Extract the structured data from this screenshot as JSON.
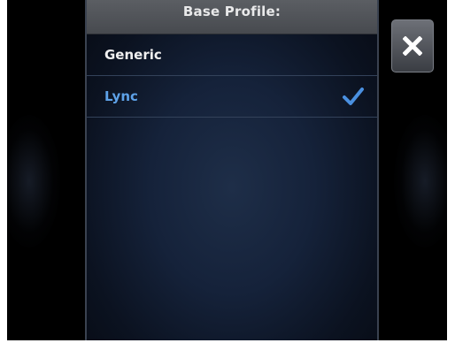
{
  "dialog": {
    "title": "Base Profile:",
    "options": [
      {
        "label": "Generic",
        "selected": false
      },
      {
        "label": "Lync",
        "selected": true
      }
    ],
    "check_icon": "checkmark-icon",
    "close_icon": "close-icon"
  },
  "colors": {
    "selected_text": "#5ea2e8",
    "unselected_text": "#f0f0f0",
    "header_bg": "#4f5257",
    "panel_bg": "#15223a",
    "checkmark": "#4a90e0"
  }
}
